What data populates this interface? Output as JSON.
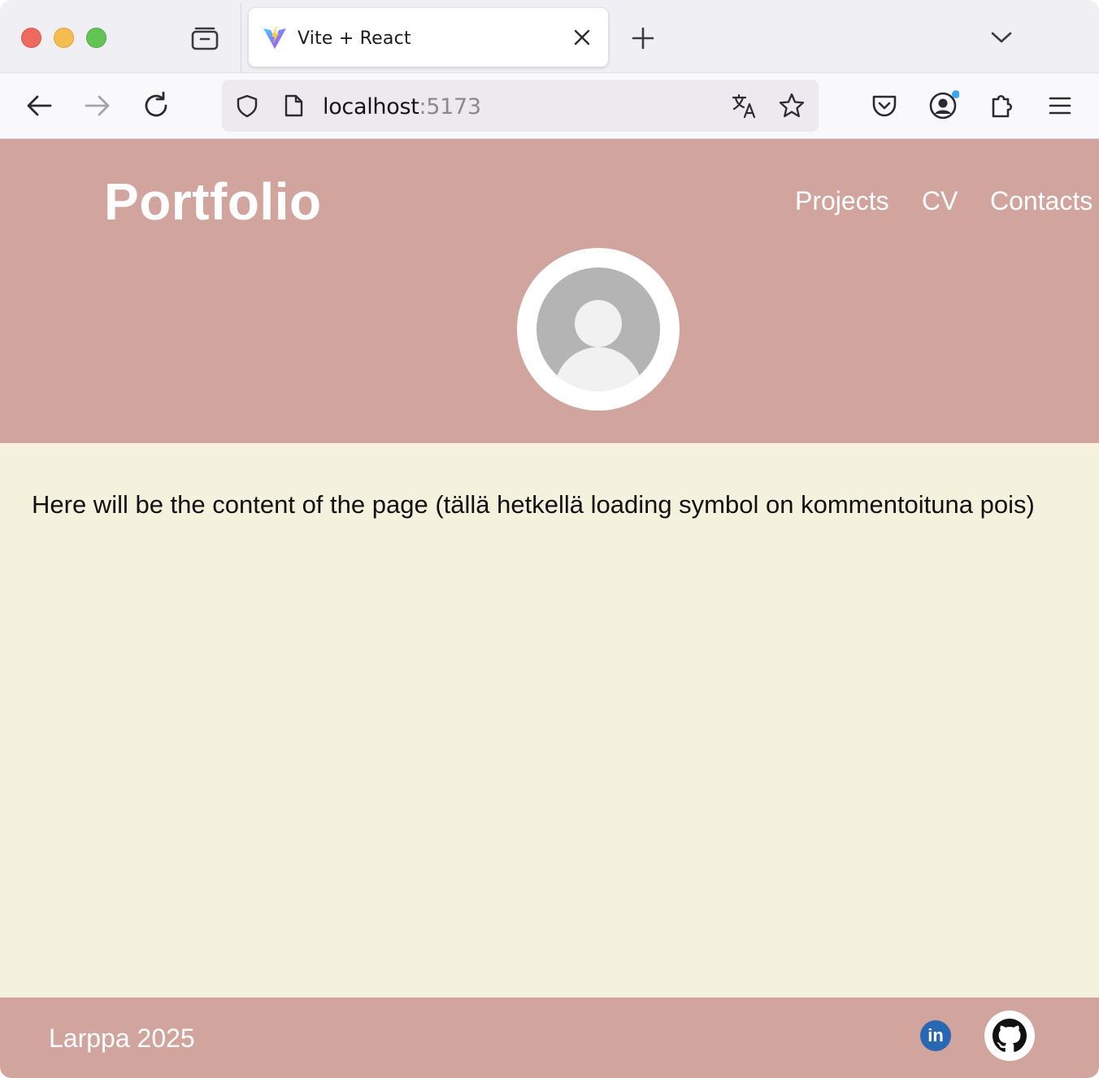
{
  "browser": {
    "tab": {
      "title": "Vite + React",
      "favicon": "vite-logo"
    },
    "url": {
      "host": "localhost",
      "port": ":5173"
    },
    "icons": {
      "tab_list": "tab-list-icon",
      "close_tab": "close-icon",
      "new_tab": "plus-icon",
      "tab_overflow": "chevron-down-icon",
      "back": "arrow-left-icon",
      "forward": "arrow-right-icon",
      "reload": "reload-icon",
      "shield": "shield-icon",
      "page": "page-icon",
      "translate": "translate-icon",
      "bookmark": "star-icon",
      "pocket": "pocket-icon",
      "account": "account-icon",
      "extensions": "puzzle-icon",
      "menu": "hamburger-menu-icon"
    }
  },
  "header": {
    "brand": "Portfolio",
    "nav": [
      "Projects",
      "CV",
      "Contacts"
    ]
  },
  "main": {
    "content": "Here will be the content of the page (tällä hetkellä loading symbol on kommentoituna pois)"
  },
  "footer": {
    "text": "Larppa 2025",
    "linkedin_label": "in",
    "social": [
      "linkedin-icon",
      "github-icon"
    ]
  },
  "colors": {
    "header_bg": "#d1a49e",
    "page_bg": "#f4f1dd",
    "linkedin": "#2867b2"
  }
}
